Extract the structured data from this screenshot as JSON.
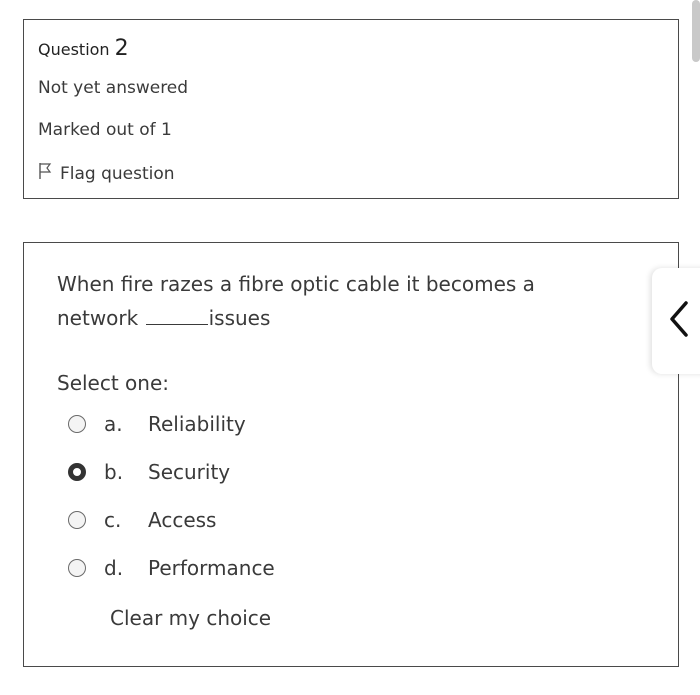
{
  "question": {
    "label": "Question",
    "number": "2",
    "status": "Not yet answered",
    "marks": "Marked out of 1",
    "flag_label": "Flag question"
  },
  "content": {
    "text_before": "When fire razes a fibre optic cable it becomes a network",
    "text_after": "issues",
    "prompt": "Select one:",
    "options": [
      {
        "letter": "a.",
        "label": "Reliability",
        "selected": false
      },
      {
        "letter": "b.",
        "label": "Security",
        "selected": true
      },
      {
        "letter": "c.",
        "label": "Access",
        "selected": false
      },
      {
        "letter": "d.",
        "label": "Performance",
        "selected": false
      }
    ],
    "clear_label": "Clear my choice"
  },
  "icons": {
    "flag": "flag-icon",
    "nav": "chevron-left-icon"
  }
}
